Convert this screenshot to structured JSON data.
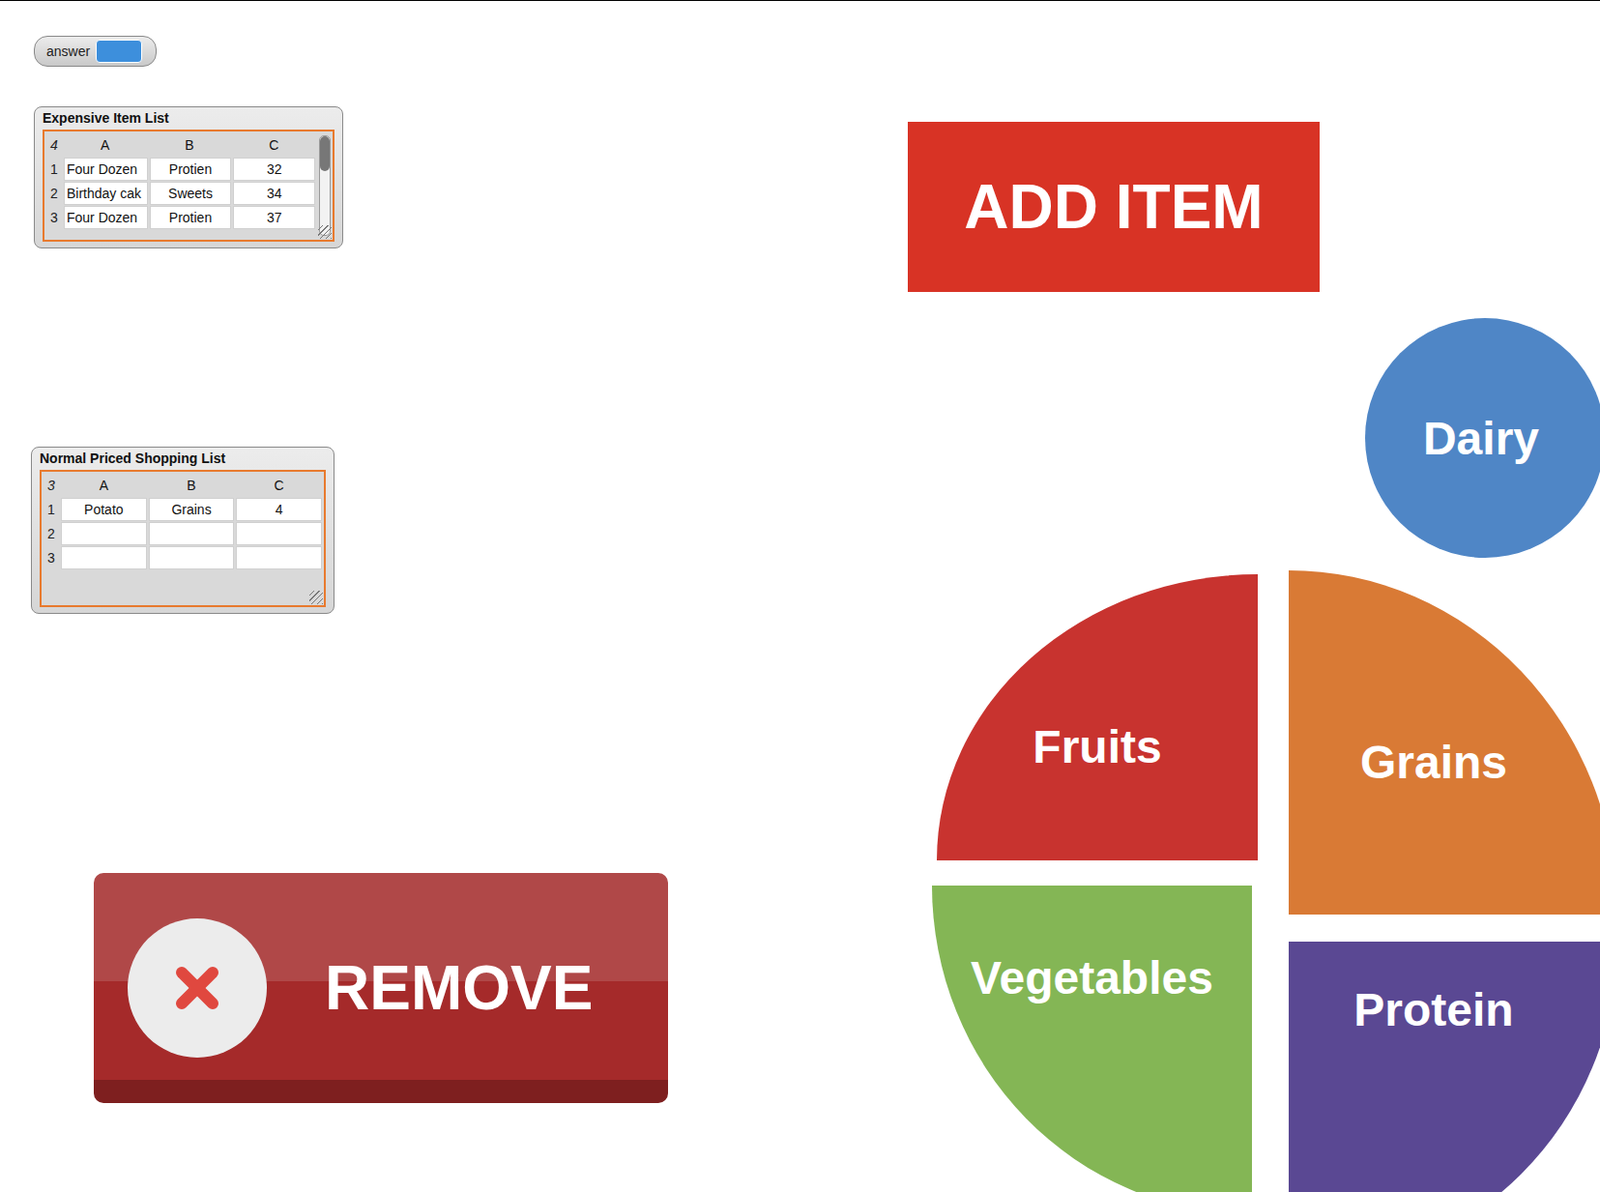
{
  "stage": {
    "answer_watcher": {
      "label": "answer",
      "value": ""
    },
    "lists": [
      {
        "title": "Expensive Item List",
        "length": "4",
        "columns": [
          "A",
          "B",
          "C"
        ],
        "scrollbar": true,
        "rows": [
          {
            "index": "1",
            "cells": [
              "Four Dozen",
              "Protien",
              "32"
            ]
          },
          {
            "index": "2",
            "cells": [
              "Birthday cak",
              "Sweets",
              "34"
            ]
          },
          {
            "index": "3",
            "cells": [
              "Four Dozen",
              "Protien",
              "37"
            ]
          }
        ]
      },
      {
        "title": "Normal Priced Shopping List",
        "length": "3",
        "columns": [
          "A",
          "B",
          "C"
        ],
        "scrollbar": false,
        "rows": [
          {
            "index": "1",
            "cells": [
              "Potato",
              "Grains",
              "4"
            ]
          },
          {
            "index": "2",
            "cells": [
              "",
              "",
              ""
            ]
          },
          {
            "index": "3",
            "cells": [
              "",
              "",
              ""
            ]
          }
        ]
      }
    ],
    "add_button": {
      "label": "ADD ITEM"
    },
    "remove_button": {
      "label": "REMOVE"
    },
    "food_groups": [
      {
        "label": "Dairy",
        "kind": "circle",
        "color": "#4f86c6"
      },
      {
        "label": "Fruits",
        "kind": "quarter",
        "color": "#c8332f"
      },
      {
        "label": "Grains",
        "kind": "quarter",
        "color": "#d97a35"
      },
      {
        "label": "Vegetables",
        "kind": "quarter",
        "color": "#84b655"
      },
      {
        "label": "Protein",
        "kind": "quarter",
        "color": "#5a4893"
      }
    ]
  }
}
